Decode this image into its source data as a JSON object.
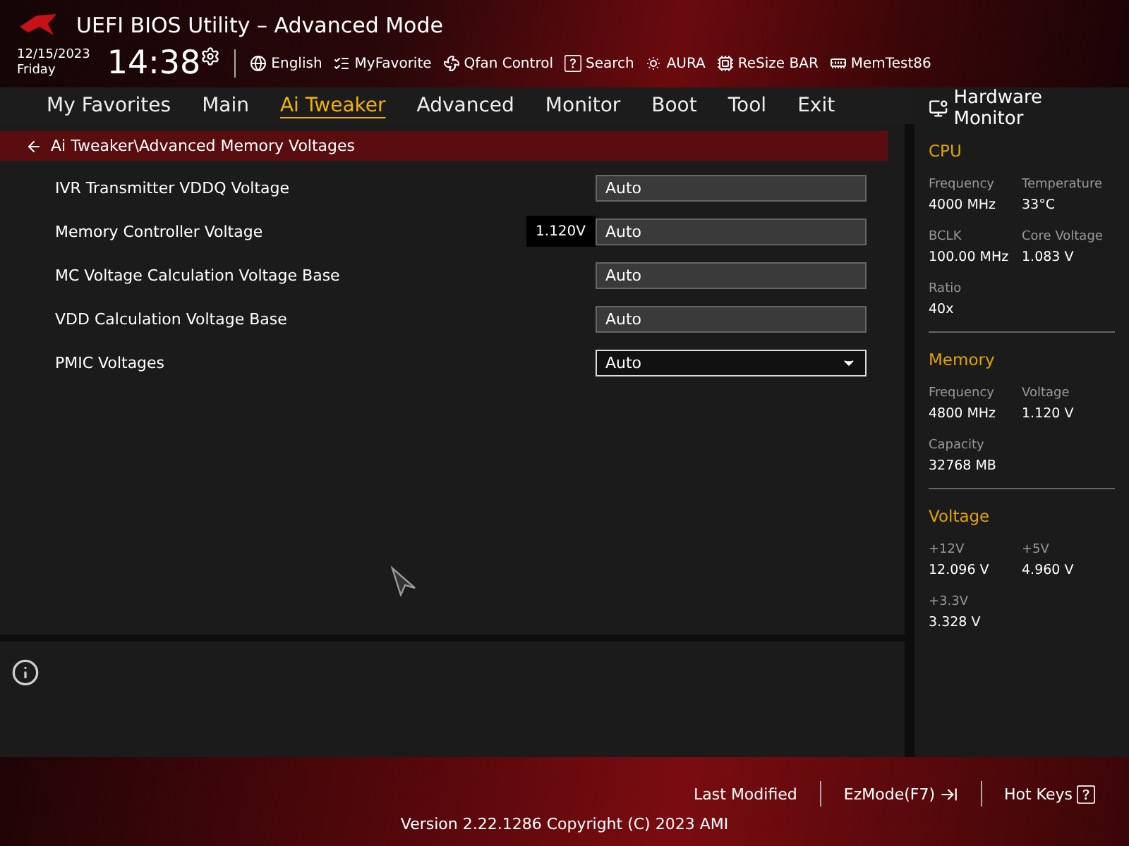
{
  "window": {
    "title": "UEFI BIOS Utility – Advanced Mode"
  },
  "clock": {
    "date": "12/15/2023",
    "day": "Friday",
    "time": "14:38"
  },
  "toolbar": [
    {
      "kind": "language",
      "label": "English"
    },
    {
      "kind": "favorite",
      "label": "MyFavorite"
    },
    {
      "kind": "fan",
      "label": "Qfan Control"
    },
    {
      "kind": "search",
      "label": "Search"
    },
    {
      "kind": "aura",
      "label": "AURA"
    },
    {
      "kind": "bar",
      "label": "ReSize BAR"
    },
    {
      "kind": "memtest",
      "label": "MemTest86"
    }
  ],
  "tabs": [
    {
      "label": "My Favorites",
      "selected": false
    },
    {
      "label": "Main",
      "selected": false
    },
    {
      "label": "Ai Tweaker",
      "selected": true
    },
    {
      "label": "Advanced",
      "selected": false
    },
    {
      "label": "Monitor",
      "selected": false
    },
    {
      "label": "Boot",
      "selected": false
    },
    {
      "label": "Tool",
      "selected": false
    },
    {
      "label": "Exit",
      "selected": false
    }
  ],
  "breadcrumb": "Ai Tweaker\\Advanced Memory Voltages",
  "settings": [
    {
      "label": "IVR Transmitter VDDQ Voltage",
      "kind": "text",
      "value": "Auto"
    },
    {
      "label": "Memory Controller Voltage",
      "kind": "text",
      "value": "Auto",
      "hint": "1.120V"
    },
    {
      "label": "MC Voltage Calculation Voltage Base",
      "kind": "text",
      "value": "Auto"
    },
    {
      "label": "VDD Calculation Voltage Base",
      "kind": "text",
      "value": "Auto"
    },
    {
      "label": "PMIC Voltages",
      "kind": "dropdown",
      "value": "Auto"
    }
  ],
  "hardware_monitor": {
    "title": "Hardware Monitor",
    "sections": [
      {
        "title": "CPU",
        "items": [
          {
            "label": "Frequency",
            "value": "4000 MHz"
          },
          {
            "label": "Temperature",
            "value": "33°C"
          },
          {
            "label": "BCLK",
            "value": "100.00 MHz"
          },
          {
            "label": "Core Voltage",
            "value": "1.083 V"
          },
          {
            "label": "Ratio",
            "value": "40x"
          }
        ]
      },
      {
        "title": "Memory",
        "items": [
          {
            "label": "Frequency",
            "value": "4800 MHz"
          },
          {
            "label": "Voltage",
            "value": "1.120 V"
          },
          {
            "label": "Capacity",
            "value": "32768 MB"
          }
        ]
      },
      {
        "title": "Voltage",
        "items": [
          {
            "label": "+12V",
            "value": "12.096 V"
          },
          {
            "label": "+5V",
            "value": "4.960 V"
          },
          {
            "label": "+3.3V",
            "value": "3.328 V"
          }
        ]
      }
    ]
  },
  "footer": {
    "actions": [
      {
        "kind": "plain",
        "label": "Last Modified"
      },
      {
        "kind": "ezmode",
        "label": "EzMode(F7)"
      },
      {
        "kind": "hotkeys",
        "label": "Hot Keys"
      }
    ],
    "version": "Version 2.22.1286 Copyright (C) 2023 AMI"
  }
}
